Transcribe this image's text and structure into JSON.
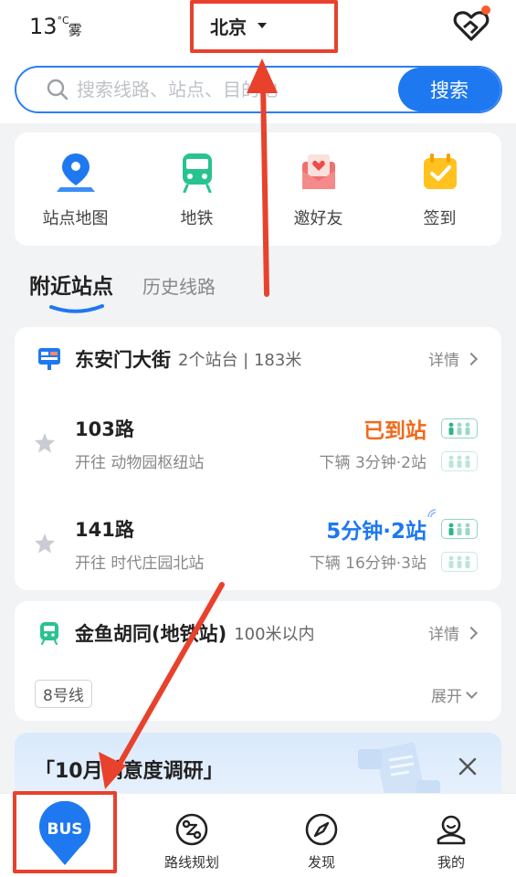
{
  "header": {
    "temperature": "13",
    "temp_unit": "°C",
    "weather": "雾",
    "city": "北京",
    "heart_icon": "heart-hands-icon"
  },
  "search": {
    "placeholder": "搜索线路、站点、目的地",
    "button_label": "搜索"
  },
  "quick_entries": [
    {
      "label": "站点地图",
      "icon": "map-pin-icon"
    },
    {
      "label": "地铁",
      "icon": "subway-icon"
    },
    {
      "label": "邀好友",
      "icon": "invite-envelope-icon"
    },
    {
      "label": "签到",
      "icon": "calendar-check-icon"
    }
  ],
  "tabs": [
    {
      "label": "附近站点",
      "active": true
    },
    {
      "label": "历史线路",
      "active": false
    }
  ],
  "station1": {
    "name": "东安门大街",
    "meta": "2个站台 | 183米",
    "detail_label": "详情",
    "routes": [
      {
        "name": "103路",
        "direction": "开往 动物园枢纽站",
        "status": "已到站",
        "status_color": "#f06a1c",
        "next": "下辆  3分钟·2站"
      },
      {
        "name": "141路",
        "direction": "开往 时代庄园北站",
        "status": "5分钟·2站",
        "status_color": "#1e78f0",
        "next": "下辆  16分钟·3站"
      }
    ]
  },
  "station2": {
    "name": "金鱼胡同(地铁站)",
    "meta": "100米以内",
    "detail_label": "详情",
    "line_tag": "8号线",
    "expand_label": "展开"
  },
  "banner": {
    "text": "「10月满意度调研」"
  },
  "bottom_nav": [
    {
      "label": "BUS",
      "icon": "bus-location-icon"
    },
    {
      "label": "路线规划",
      "icon": "route-plan-icon"
    },
    {
      "label": "发现",
      "icon": "compass-icon"
    },
    {
      "label": "我的",
      "icon": "profile-icon"
    }
  ],
  "colors": {
    "accent": "#1e78f0",
    "annotation": "#e8412c",
    "subway_green": "#29c291"
  }
}
